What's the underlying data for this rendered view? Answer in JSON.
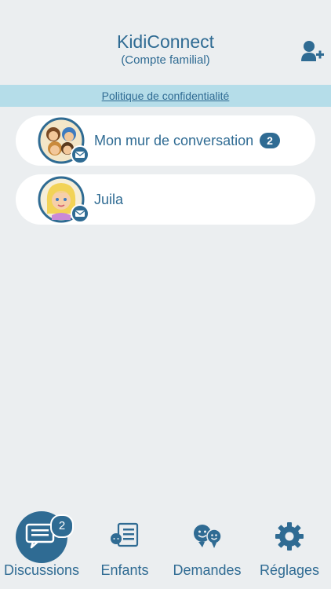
{
  "header": {
    "title": "KidiConnect",
    "subtitle": "(Compte familial)",
    "add_user_icon": "add-user-icon"
  },
  "policy": {
    "link": "Politique de confidentialité"
  },
  "conversations": [
    {
      "label": "Mon mur de conversation",
      "badge": "2",
      "avatar": "family-group-avatar",
      "status_icon": "envelope-icon"
    },
    {
      "label": "Juila",
      "avatar": "girl-avatar",
      "status_icon": "envelope-icon"
    }
  ],
  "tabs": [
    {
      "label": "Discussions",
      "icon": "chat-bubbles-icon",
      "badge": "2",
      "active": true
    },
    {
      "label": "Enfants",
      "icon": "child-list-icon"
    },
    {
      "label": "Demandes",
      "icon": "smiley-pair-icon"
    },
    {
      "label": "Réglages",
      "icon": "gear-icon"
    }
  ],
  "colors": {
    "accent": "#2f6b93",
    "policy_bar": "#b5dde9",
    "background": "#ebeef0",
    "card": "#ffffff"
  }
}
